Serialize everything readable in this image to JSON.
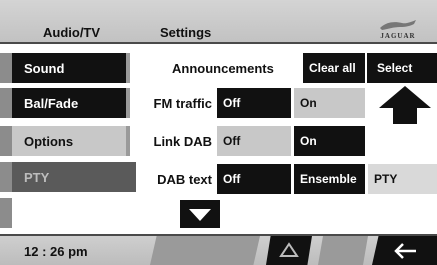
{
  "header": {
    "audio_tv_label": "Audio/TV",
    "settings_label": "Settings",
    "brand": "JAGUAR"
  },
  "sidebar": {
    "items": [
      {
        "label": "Sound"
      },
      {
        "label": "Bal/Fade"
      },
      {
        "label": "Options"
      },
      {
        "label": "PTY"
      }
    ]
  },
  "announcements": {
    "title": "Announcements",
    "clear_all_label": "Clear all",
    "select_label": "Select",
    "rows": [
      {
        "label": "FM traffic",
        "option_a": "Off",
        "option_b": "On"
      },
      {
        "label": "Link DAB",
        "option_a": "Off",
        "option_b": "On"
      },
      {
        "label": "DAB text",
        "option_a": "Off",
        "option_b": "Ensemble",
        "option_c": "PTY"
      }
    ]
  },
  "footer": {
    "clock": "12 : 26 pm"
  },
  "icons": {
    "up_arrow": "up-arrow-icon",
    "down_arrow": "down-arrow-icon",
    "eject": "eject-icon",
    "back": "back-arrow-icon"
  }
}
